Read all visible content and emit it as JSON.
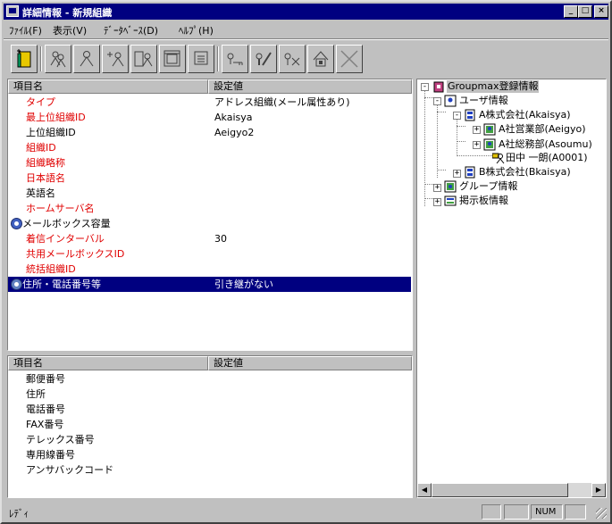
{
  "window": {
    "title": "詳細情報 - 新規組織",
    "min_glyph": "_",
    "max_glyph": "□",
    "close_glyph": "×"
  },
  "menu": [
    "ﾌｧｲﾙ(F)",
    "表示(V)",
    "ﾃﾞｰﾀﾍﾞｰｽ(D)",
    "ﾍﾙﾌﾟ(H)"
  ],
  "toolbar_icons": [
    "open-book-icon",
    "users-icon",
    "user-icon",
    "add-user-icon",
    "group-user-icon",
    "window-icon",
    "window-alt-icon",
    "key-icon",
    "edit-icon",
    "delete-user-icon",
    "lock-icon",
    "close-x-icon"
  ],
  "attributes_table": {
    "headers": [
      "項目名",
      "設定値"
    ],
    "rows": [
      {
        "name": "タイプ",
        "value": "アドレス組織(メール属性あり)",
        "required": true
      },
      {
        "name": "最上位組織ID",
        "value": "Akaisya",
        "required": true
      },
      {
        "name": "上位組織ID",
        "value": "Aeigyo2",
        "required": false
      },
      {
        "name": "組織ID",
        "value": "",
        "required": true
      },
      {
        "name": "組織略称",
        "value": "",
        "required": true
      },
      {
        "name": "日本語名",
        "value": "",
        "required": true
      },
      {
        "name": "英語名",
        "value": "",
        "required": false
      },
      {
        "name": "ホームサーバ名",
        "value": "",
        "required": true
      },
      {
        "name": "メールボックス容量",
        "value": "",
        "required": false,
        "icon": "magnify-icon"
      },
      {
        "name": "着信インターバル",
        "value": "30",
        "required": true
      },
      {
        "name": "共用メールボックスID",
        "value": "",
        "required": true
      },
      {
        "name": "統括組織ID",
        "value": "",
        "required": true
      },
      {
        "name": "住所・電話番号等",
        "value": "引き継がない",
        "required": false,
        "icon": "globe-icon",
        "selected": true
      }
    ]
  },
  "address_table": {
    "headers": [
      "項目名",
      "設定値"
    ],
    "rows": [
      "郵便番号",
      "住所",
      "電話番号",
      "FAX番号",
      "テレックス番号",
      "専用線番号",
      "アンサバックコード"
    ]
  },
  "tree": {
    "root": "Groupmax登録情報",
    "user_info": "ユーザ情報",
    "company_a": "A株式会社(Akaisya)",
    "dept_sales": "A社営業部(Aeigyo)",
    "dept_general": "A社総務部(Asoumu)",
    "person": "田中 一朗(A0001)",
    "company_b": "B株式会社(Bkaisya)",
    "group_info": "グループ情報",
    "board_info": "掲示板情報"
  },
  "statusbar": {
    "text": "ﾚﾃﾞｨ",
    "num": "NUM"
  },
  "colors": {
    "title_bg": "#000080",
    "selection": "#000080",
    "required_text": "#e00000",
    "face": "#c0c0c0"
  }
}
